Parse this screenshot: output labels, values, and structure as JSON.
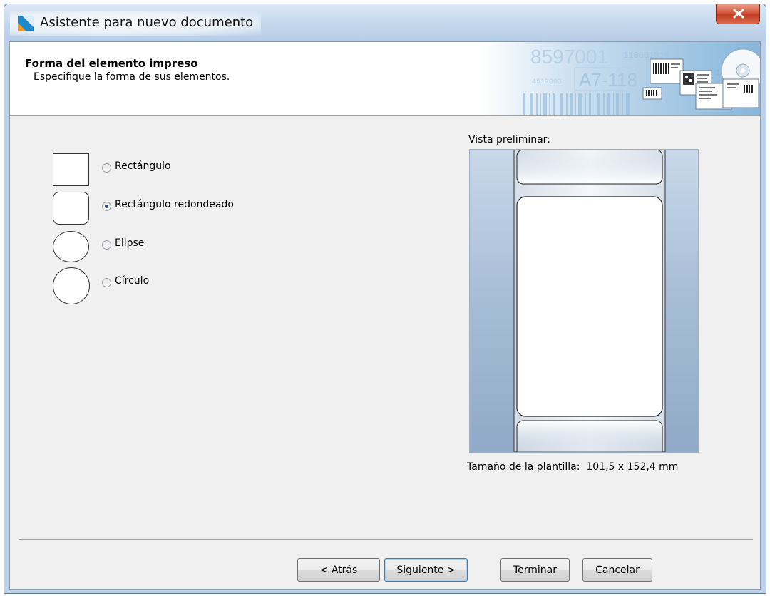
{
  "window": {
    "title": "Asistente para nuevo documento",
    "close_label": "x"
  },
  "header": {
    "title": "Forma del elemento impreso",
    "subtitle": "Especifique la forma de sus elementos.",
    "banner_text_1": "8597001",
    "banner_text_2": "A7-118",
    "banner_text_3": "110001010",
    "banner_text_4": "4512003"
  },
  "shapes": {
    "selected": "Rectángulo redondeado",
    "options": [
      {
        "label": "Rectángulo",
        "icon": "rectangle-icon",
        "checked": false
      },
      {
        "label": "Rectángulo redondeado",
        "icon": "rounded-rectangle-icon",
        "checked": true
      },
      {
        "label": "Elipse",
        "icon": "ellipse-icon",
        "checked": false
      },
      {
        "label": "Círculo",
        "icon": "circle-icon",
        "checked": false
      }
    ]
  },
  "preview": {
    "label": "Vista preliminar:",
    "size_caption": "Tamaño de la plantilla:  101,5 x 152,4 mm"
  },
  "buttons": {
    "back": "< Atrás",
    "next": "Siguiente >",
    "finish": "Terminar",
    "cancel": "Cancelar"
  },
  "colors": {
    "close_button": "#c7472c",
    "preview_background": "#a9bfd8",
    "default_button_border": "#3c7fb1"
  }
}
